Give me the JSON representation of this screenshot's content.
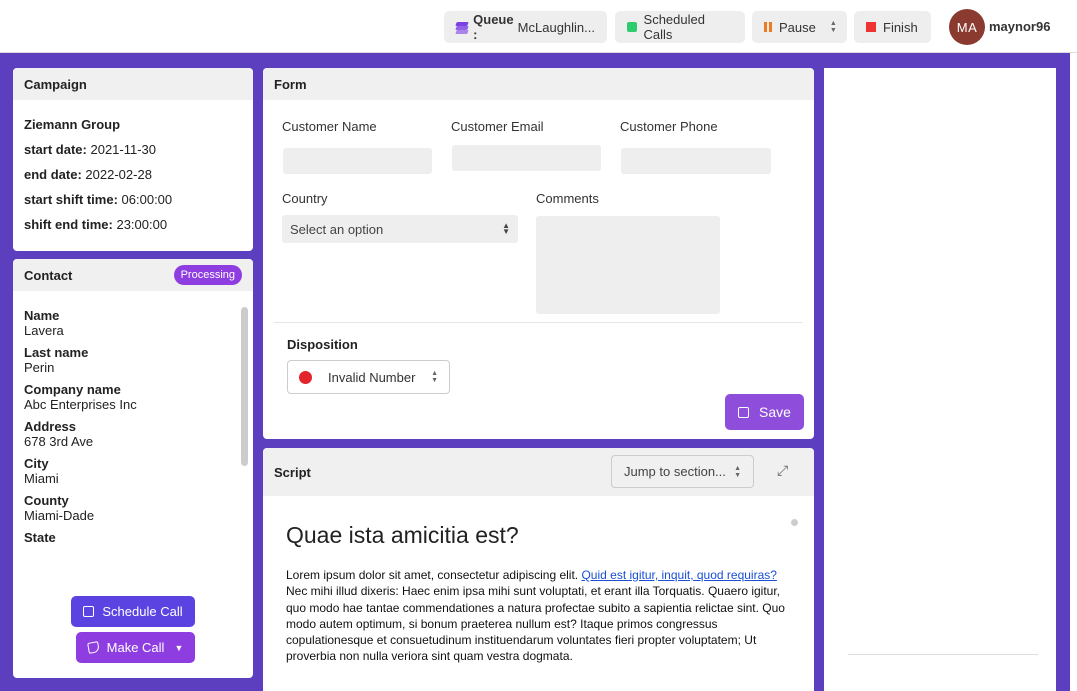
{
  "topbar": {
    "queue_prefix": "Queue : ",
    "queue_name": "McLaughlin...",
    "scheduled_calls": "Scheduled Calls",
    "pause": "Pause",
    "finish": "Finish",
    "avatar_initials": "MA",
    "username": "maynor96"
  },
  "campaign": {
    "title": "Campaign",
    "name": "Ziemann Group",
    "start_date_label": "start date:",
    "start_date": "2021-11-30",
    "end_date_label": "end date:",
    "end_date": "2022-02-28",
    "start_shift_label": "start shift time:",
    "start_shift": "06:00:00",
    "end_shift_label": "shift end time:",
    "end_shift": "23:00:00"
  },
  "contact": {
    "title": "Contact",
    "status": "Processing",
    "fields": [
      {
        "label": "Name",
        "value": "Lavera"
      },
      {
        "label": "Last name",
        "value": "Perin"
      },
      {
        "label": "Company name",
        "value": "Abc Enterprises Inc"
      },
      {
        "label": "Address",
        "value": "678 3rd Ave"
      },
      {
        "label": "City",
        "value": "Miami"
      },
      {
        "label": "County",
        "value": "Miami-Dade"
      },
      {
        "label": "State",
        "value": ""
      }
    ],
    "schedule_call": "Schedule Call",
    "make_call": "Make Call"
  },
  "form": {
    "title": "Form",
    "customer_name_label": "Customer Name",
    "customer_email_label": "Customer Email",
    "customer_phone_label": "Customer Phone",
    "country_label": "Country",
    "country_placeholder": "Select an option",
    "comments_label": "Comments",
    "disposition_label": "Disposition",
    "disposition_value": "Invalid Number",
    "disposition_color": "#e2252b",
    "save": "Save"
  },
  "script": {
    "title": "Script",
    "jump": "Jump to section...",
    "heading": "Quae ista amicitia est?",
    "text_before_link": "Lorem ipsum dolor sit amet, consectetur adipiscing elit. ",
    "link_text": "Quid est igitur, inquit, quod requiras?",
    "text_after_link": " Nec mihi illud dixeris: Haec enim ipsa mihi sunt voluptati, et erant illa Torquatis. Quaero igitur, quo modo hae tantae commendationes a natura profectae subito a sapientia relictae sint. Quo modo autem optimum, si bonum praeterea nullum est? Itaque primos congressus copulationesque et consuetudinum instituendarum voluntates fieri propter voluptatem; Ut proverbia non nulla veriora sint quam vestra dogmata."
  },
  "colors": {
    "brand": "#5b3fbf",
    "accent": "#8e3ee0",
    "schedule_button": "#5a43e0"
  }
}
